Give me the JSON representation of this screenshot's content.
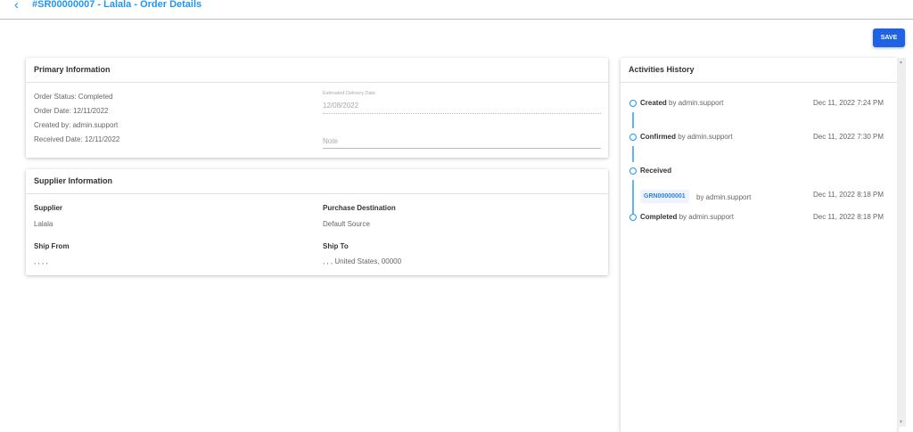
{
  "header": {
    "back_icon": "chevron-left",
    "title": "#SR00000007 - Lalala - Order Details"
  },
  "toolbar": {
    "save_label": "SAVE",
    "save_color": "#1e63e6"
  },
  "primary": {
    "title": "Primary Information",
    "order_status": "Order Status: Completed",
    "order_date": "Order Date: 12/11/2022",
    "created_by": "Created by: admin.support",
    "received_date": "Received Date: 12/11/2022",
    "est_label": "Estimated Delivery Date",
    "est_value": "12/08/2022",
    "note_placeholder": "Note"
  },
  "supplier": {
    "title": "Supplier Information",
    "supplier_label": "Supplier",
    "supplier_value": "Lalala",
    "dest_label": "Purchase Destination",
    "dest_value": "Default Source",
    "from_label": "Ship From",
    "from_value": ", , , ,",
    "to_label": "Ship To",
    "to_value": ", , , United States, 00000"
  },
  "activities": {
    "title": "Activities History",
    "items": [
      {
        "action": "Created",
        "by": "by admin.support",
        "time": "Dec 11, 2022 7:24 PM"
      },
      {
        "action": "Confirmed",
        "by": "by admin.support",
        "time": "Dec 11, 2022 7:30 PM"
      },
      {
        "action": "Received",
        "by": "",
        "time": ""
      },
      {
        "action": "Completed",
        "by": "by admin.support",
        "time": "Dec 11, 2022 8:18 PM"
      }
    ],
    "grn": {
      "code": "GRN00000001",
      "by": "by admin.support",
      "time": "Dec 11, 2022 8:18 PM"
    }
  }
}
